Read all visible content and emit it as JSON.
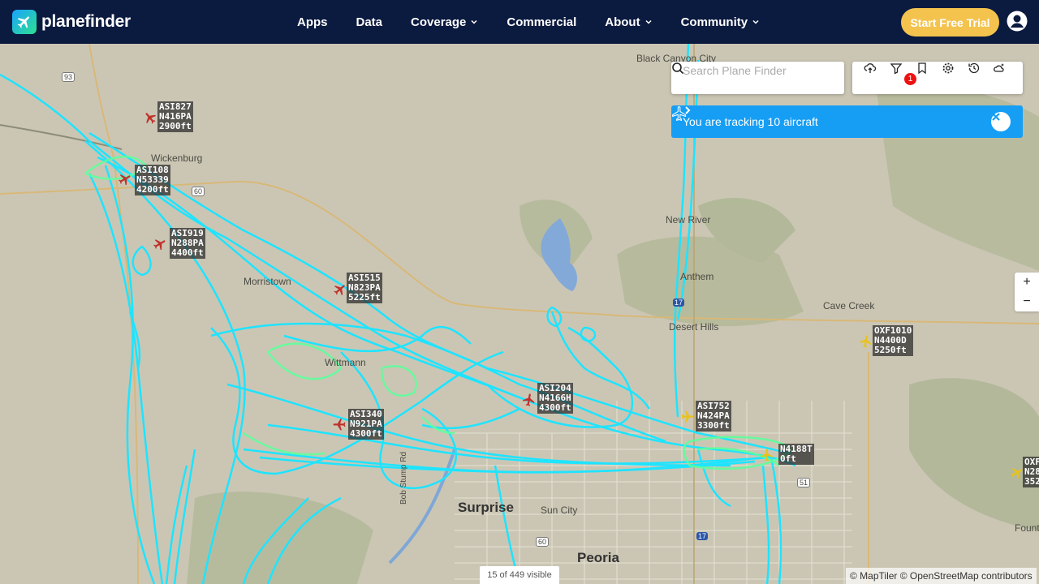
{
  "brand": {
    "name": "planefinder"
  },
  "nav": {
    "items": [
      {
        "label": "Apps",
        "has_menu": false
      },
      {
        "label": "Data",
        "has_menu": false
      },
      {
        "label": "Coverage",
        "has_menu": true
      },
      {
        "label": "Commercial",
        "has_menu": false
      },
      {
        "label": "About",
        "has_menu": true
      },
      {
        "label": "Community",
        "has_menu": true
      }
    ],
    "cta_label": "Start Free Trial"
  },
  "search": {
    "placeholder": "Search Plane Finder",
    "value": ""
  },
  "toolbar": {
    "icons": [
      "cloud-icon",
      "filter-icon",
      "bookmark-icon",
      "settings-icon",
      "history-icon",
      "weather-icon"
    ],
    "filter_badge": "1"
  },
  "tracking": {
    "text": "You are tracking 10 aircraft"
  },
  "zoom": {
    "in": "+",
    "out": "−"
  },
  "status": {
    "visible": "15 of 449 visible"
  },
  "attribution": "© MapTiler © OpenStreetMap contributors",
  "places": [
    {
      "name": "Black Canyon City",
      "size": "small"
    },
    {
      "name": "Wickenburg",
      "size": "small"
    },
    {
      "name": "Morristown",
      "size": "small"
    },
    {
      "name": "Wittmann",
      "size": "small"
    },
    {
      "name": "New River",
      "size": "small"
    },
    {
      "name": "Anthem",
      "size": "small"
    },
    {
      "name": "Desert Hills",
      "size": "small"
    },
    {
      "name": "Cave Creek",
      "size": "small"
    },
    {
      "name": "Surprise",
      "size": "big"
    },
    {
      "name": "Sun City",
      "size": "small"
    },
    {
      "name": "Peoria",
      "size": "big"
    },
    {
      "name": "Fountain Hills",
      "size": "small"
    },
    {
      "name": "Bob Stump Rd",
      "size": "small"
    }
  ],
  "highway_shields": [
    "93",
    "60",
    "17",
    "51",
    "17",
    "60"
  ],
  "aircraft": [
    {
      "callsign": "ASI827",
      "reg": "N416PA",
      "alt": "2900ft",
      "color": "red"
    },
    {
      "callsign": "ASI108",
      "reg": "N53339",
      "alt": "4200ft",
      "color": "red"
    },
    {
      "callsign": "ASI919",
      "reg": "N288PA",
      "alt": "4400ft",
      "color": "red"
    },
    {
      "callsign": "ASI515",
      "reg": "N823PA",
      "alt": "5225ft",
      "color": "red"
    },
    {
      "callsign": "ASI204",
      "reg": "N4166H",
      "alt": "4300ft",
      "color": "red"
    },
    {
      "callsign": "ASI340",
      "reg": "N921PA",
      "alt": "4300ft",
      "color": "red"
    },
    {
      "callsign": "ASI752",
      "reg": "N424PA",
      "alt": "3300ft",
      "color": "yellow"
    },
    {
      "callsign": "OXF1010",
      "reg": "N4400D",
      "alt": "5250ft",
      "color": "yellow"
    },
    {
      "callsign": "N4188T",
      "reg": "",
      "alt": "0ft",
      "color": "yellow"
    },
    {
      "callsign": "OXF",
      "reg": "N28",
      "alt": "352",
      "color": "yellow"
    }
  ],
  "colors": {
    "topbar": "#0b1a3f",
    "cta": "#f4c34e",
    "tracking": "#169ef5",
    "track_cyan": "#1ee4ff",
    "track_green": "#5dff9c",
    "plane_red": "#c0312b",
    "plane_yellow": "#e8c21a"
  }
}
